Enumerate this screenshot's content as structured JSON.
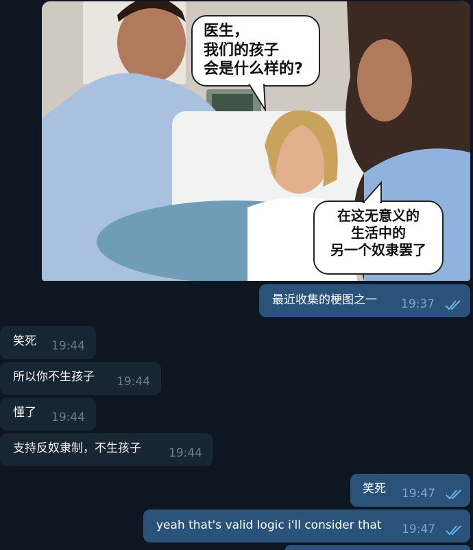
{
  "meme": {
    "bubble_top": [
      "医生，",
      "我们的孩子",
      "会是什么样的?"
    ],
    "bubble_bottom": [
      "在这无意义的",
      "生活中的",
      "另一个奴隶罢了"
    ]
  },
  "messages": [
    {
      "side": "out",
      "text": "最近收集的梗图之一",
      "time": "19:37",
      "status": "read-double-check"
    },
    {
      "side": "in",
      "text": "笑死",
      "time": "19:44"
    },
    {
      "side": "in",
      "text": "所以你不生孩子",
      "time": "19:44"
    },
    {
      "side": "in",
      "text": "懂了",
      "time": "19:44"
    },
    {
      "side": "in",
      "text": "支持反奴隶制，不生孩子",
      "time": "19:44"
    },
    {
      "side": "out",
      "text": "笑死",
      "time": "19:47",
      "status": "read-double-check"
    },
    {
      "side": "out",
      "text": "yeah that's valid logic i'll consider that",
      "time": "19:47",
      "status": "read-double-check"
    }
  ],
  "colors": {
    "background": "#0e1621",
    "outgoing_bubble": "#2b5278",
    "incoming_bubble": "#182533",
    "read_check": "#6ab3f3"
  }
}
